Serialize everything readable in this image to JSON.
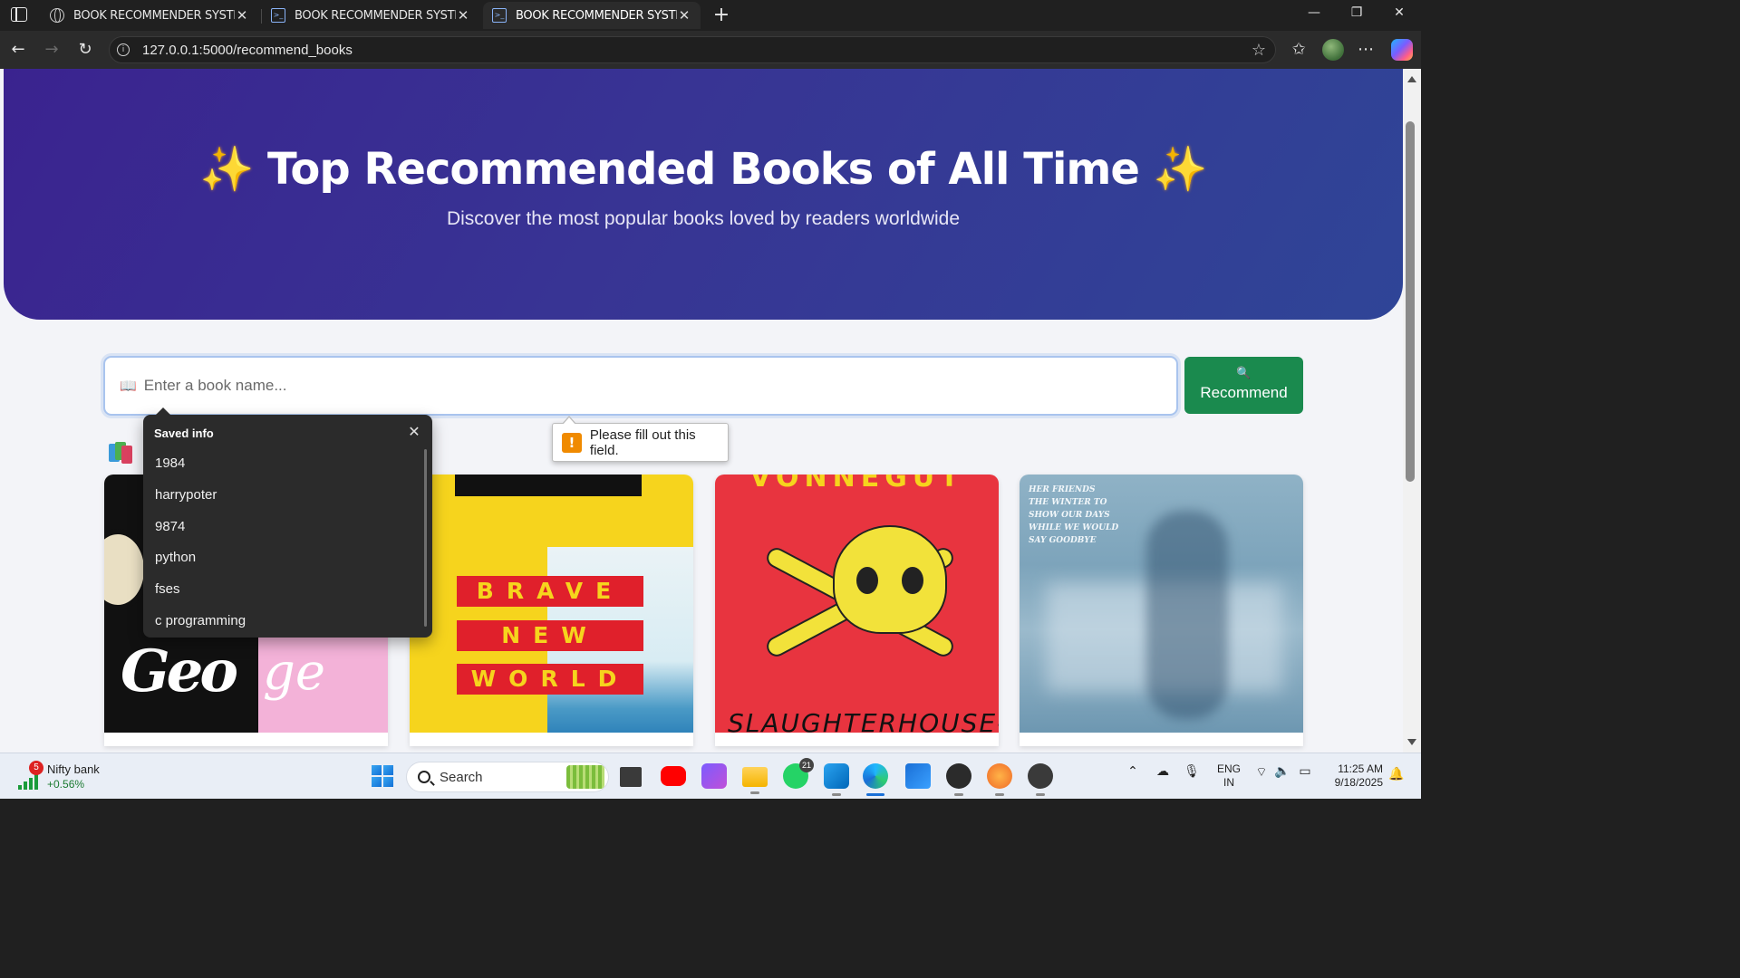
{
  "browser": {
    "tabs": [
      {
        "label": "BOOK RECOMMENDER SYSTEM",
        "icon": "globe-icon",
        "active": false
      },
      {
        "label": "BOOK RECOMMENDER SYSTEM",
        "icon": "terminal-icon",
        "active": false
      },
      {
        "label": "BOOK RECOMMENDER SYSTEM",
        "icon": "terminal-icon",
        "active": true
      }
    ],
    "url": "127.0.0.1:5000/recommend_books"
  },
  "hero": {
    "title": "Top Recommended Books of All Time",
    "sparkle": "✨",
    "subtitle": "Discover the most popular books loved by readers worldwide"
  },
  "search": {
    "placeholder": "Enter a book name...",
    "icon": "📖",
    "button_label": "Recommend",
    "button_icon": "🔍"
  },
  "autofill": {
    "title": "Saved info",
    "items": [
      "1984",
      "harrypoter",
      "9874",
      "python",
      "fses",
      "c programming"
    ]
  },
  "validation": {
    "message": "Please fill out this field."
  },
  "books": [
    {
      "cover_text": "Geo",
      "cover_text2": "ge"
    },
    {
      "cover_lines": [
        "BRAVE",
        "NEW",
        "WORLD"
      ]
    },
    {
      "top": "VONNEGUT",
      "bottom": "SLAUGHTERHOUSE-"
    },
    {
      "cover_lines": [
        "HER FRIENDS",
        "THE WINTER TO",
        "SHOW OUR DAYS",
        "WHILE WE WOULD",
        "SAY GOODBYE"
      ]
    }
  ],
  "taskbar": {
    "stock_name": "Nifty bank",
    "stock_change": "+0.56%",
    "stock_badge": "5",
    "search_label": "Search",
    "whatsapp_count": "21",
    "lang_line1": "ENG",
    "lang_line2": "IN",
    "time": "11:25 AM",
    "date": "9/18/2025"
  },
  "colors": {
    "hero_start": "#3a238f",
    "hero_end": "#2f4597",
    "recommend_button": "#1a8a4e",
    "autofill_bg": "#2b2b2b"
  }
}
